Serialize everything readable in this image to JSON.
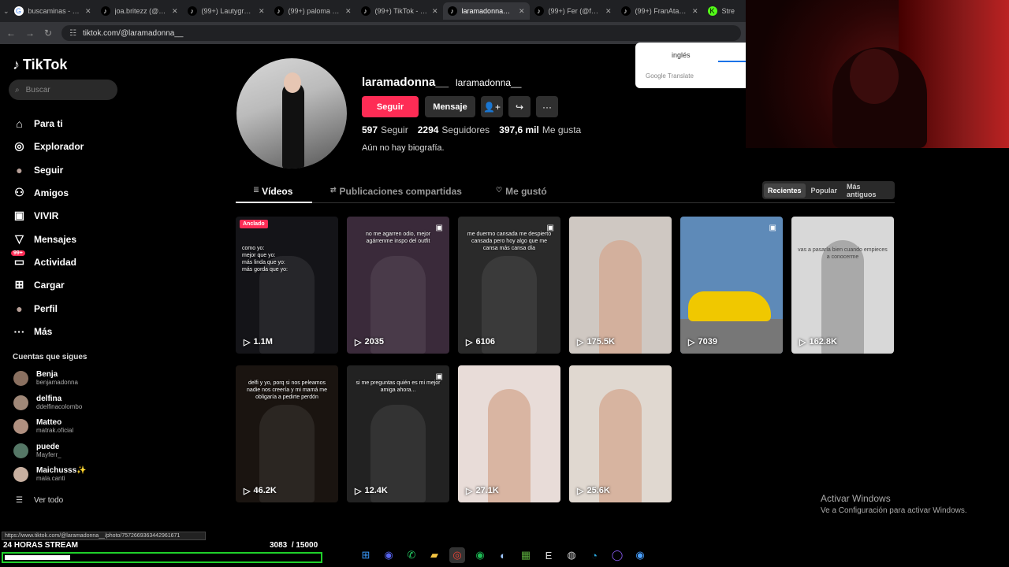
{
  "browser": {
    "tabs": [
      {
        "label": "buscaminas - Bus",
        "icon": "google-icon",
        "active": false
      },
      {
        "label": "joa.britezz (@joa",
        "icon": "tiktok-icon",
        "active": false
      },
      {
        "label": "(99+) Lautygram (",
        "icon": "tiktok-icon",
        "active": false
      },
      {
        "label": "(99+) paloma (@p",
        "icon": "tiktok-icon",
        "active": false
      },
      {
        "label": "(99+) TikTok - Haz",
        "icon": "tiktok-icon",
        "active": false
      },
      {
        "label": "laramadonna__ (@",
        "icon": "tiktok-icon",
        "active": true
      },
      {
        "label": "(99+) Fer (@fersa",
        "icon": "tiktok-icon",
        "active": false
      },
      {
        "label": "(99+) FranAtaque",
        "icon": "tiktok-icon",
        "active": false
      },
      {
        "label": "Stre",
        "icon": "kick-icon",
        "active": false
      }
    ],
    "url": "tiktok.com/@laramadonna__",
    "status_url": "https://www.tiktok.com/@laramadonna__/photo/7572669363442961671"
  },
  "translate_popup": {
    "language": "inglés",
    "brand": "Google Translate"
  },
  "sidebar": {
    "logo": "TikTok",
    "search_placeholder": "Buscar",
    "nav": [
      {
        "label": "Para ti",
        "icon": "home-icon"
      },
      {
        "label": "Explorador",
        "icon": "compass-icon"
      },
      {
        "label": "Seguir",
        "icon": "following-avatar-icon"
      },
      {
        "label": "Amigos",
        "icon": "friends-icon"
      },
      {
        "label": "VIVIR",
        "icon": "live-icon"
      },
      {
        "label": "Mensajes",
        "icon": "inbox-icon"
      },
      {
        "label": "Actividad",
        "icon": "activity-icon",
        "badge": "99+"
      },
      {
        "label": "Cargar",
        "icon": "upload-icon"
      },
      {
        "label": "Perfil",
        "icon": "profile-avatar-icon"
      },
      {
        "label": "Más",
        "icon": "more-icon"
      }
    ],
    "following_header": "Cuentas que sigues",
    "following": [
      {
        "name": "Benja",
        "handle": "benjamadonna"
      },
      {
        "name": "delfina",
        "handle": "ddelfinacolombo"
      },
      {
        "name": "Matteo",
        "handle": "matrak.oficial"
      },
      {
        "name": "puede",
        "handle": "Mayferr_"
      },
      {
        "name": "Maichusss✨",
        "handle": "mala.canti"
      }
    ],
    "see_all": "Ver todo"
  },
  "profile": {
    "username": "laramadonna__",
    "nickname": "laramadonna__",
    "follow_label": "Seguir",
    "message_label": "Mensaje",
    "stats": [
      {
        "value": "597",
        "label": "Seguir"
      },
      {
        "value": "2294",
        "label": "Seguidores"
      },
      {
        "value": "397,6 mil",
        "label": "Me gusta"
      }
    ],
    "bio": "Aún no hay biografía."
  },
  "content_tabs": [
    {
      "label": "Vídeos",
      "icon": "grid-icon"
    },
    {
      "label": "Publicaciones compartidas",
      "icon": "repost-icon"
    },
    {
      "label": "Me gustó",
      "icon": "liked-icon"
    }
  ],
  "sort": [
    "Recientes",
    "Popular",
    "Más antiguos"
  ],
  "videos": [
    {
      "views": "1.1M",
      "pinned": "Anclado",
      "caption": "como yo:\nmejor que yo:\nmás linda que yo:\nmás gorda que yo:",
      "photo": false,
      "bg": "#141418"
    },
    {
      "views": "2035",
      "caption": "no me agarren odio, mejor agárrenme inspo del outfit",
      "photo": true,
      "bg": "#3a2a3a"
    },
    {
      "views": "6106",
      "caption": "me duermo cansada me despierto cansada pero hoy algo que me cansa más cansa día",
      "photo": true,
      "bg": "#2a2a2a"
    },
    {
      "views": "175.5K",
      "caption": "",
      "photo": false,
      "bg": "#cfc8c2"
    },
    {
      "views": "7039",
      "caption": "",
      "photo": true,
      "bg": "#5e8ab8"
    },
    {
      "views": "162.8K",
      "caption": "vas a pasarla bien cuando empieces a conocerme",
      "photo": false,
      "bg": "#d8d8d8"
    },
    {
      "views": "46.2K",
      "caption": "delfi y yo, porq si nos peleamos nadie nos creería y mi mamá me obligaría a pedirte perdón",
      "photo": false,
      "bg": "#1a1410"
    },
    {
      "views": "12.4K",
      "caption": "si me preguntas quién es mi mejor amiga ahora...",
      "photo": true,
      "bg": "#222"
    },
    {
      "views": "27.1K",
      "caption": "",
      "photo": false,
      "bg": "#e8dcd8"
    },
    {
      "views": "25.6K",
      "caption": "",
      "photo": false,
      "bg": "#e0d8d0"
    }
  ],
  "stream": {
    "label": "24 HORAS STREAM",
    "count": "3083",
    "goal": "/ 15000",
    "progress": 0.2055
  },
  "windows": {
    "activate_title": "Activar Windows",
    "activate_sub": "Ve a Configuración para activar Windows."
  },
  "taskbar": [
    "windows-start-icon",
    "discord-icon",
    "whatsapp-icon",
    "file-explorer-icon",
    "chrome-icon",
    "spotify-icon",
    "steam-icon",
    "minecraft-icon",
    "epic-games-icon",
    "obs-icon",
    "edge-icon",
    "app-icon",
    "browser-icon"
  ]
}
